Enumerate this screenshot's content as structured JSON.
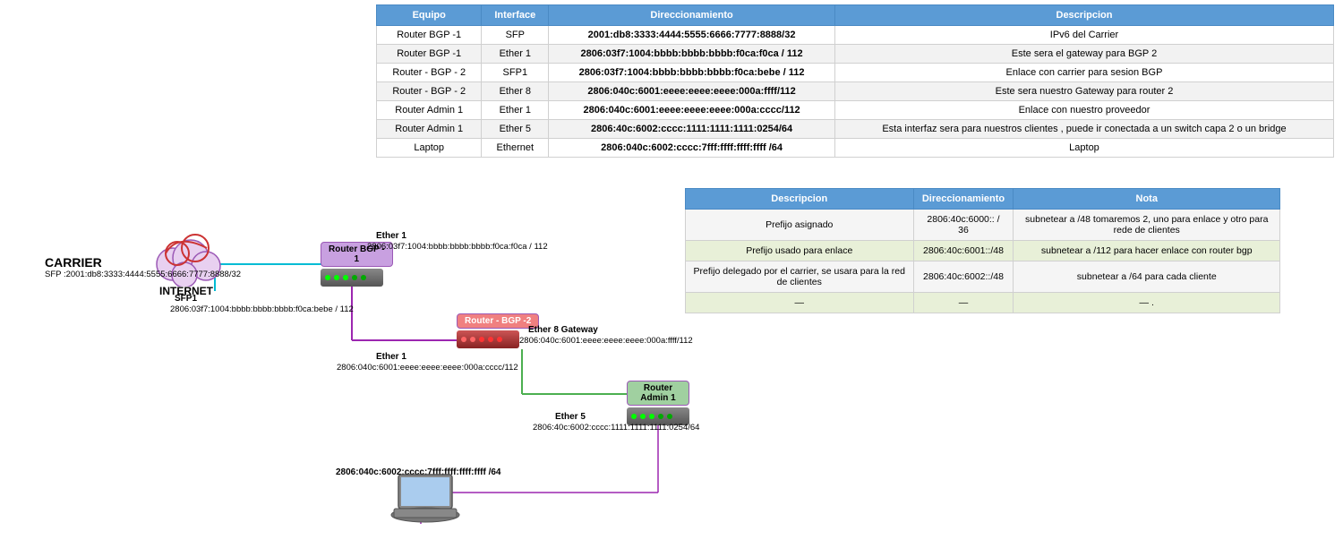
{
  "table": {
    "headers": [
      "Equipo",
      "Interface",
      "Direccionamiento",
      "Descripcion"
    ],
    "rows": [
      {
        "equipo": "Router BGP -1",
        "interface": "SFP",
        "direccionamiento": "2001:db8:3333:4444:5555:6666:7777:8888/32",
        "descripcion": "IPv6 del Carrier"
      },
      {
        "equipo": "Router BGP -1",
        "interface": "Ether 1",
        "direccionamiento": "2806:03f7:1004:bbbb:bbbb:bbbb:f0ca:f0ca / 112",
        "descripcion": "Este sera el gateway para BGP 2"
      },
      {
        "equipo": "Router - BGP - 2",
        "interface": "SFP1",
        "direccionamiento": "2806:03f7:1004:bbbb:bbbb:bbbb:f0ca:bebe / 112",
        "descripcion": "Enlace con carrier para sesion BGP"
      },
      {
        "equipo": "Router - BGP - 2",
        "interface": "Ether 8",
        "direccionamiento": "2806:040c:6001:eeee:eeee:eeee:000a:ffff/112",
        "descripcion": "Este sera nuestro Gateway para router 2"
      },
      {
        "equipo": "Router Admin 1",
        "interface": "Ether 1",
        "direccionamiento": "2806:040c:6001:eeee:eeee:eeee:000a:cccc/112",
        "descripcion": "Enlace con nuestro proveedor"
      },
      {
        "equipo": "Router Admin 1",
        "interface": "Ether 5",
        "direccionamiento": "2806:40c:6002:cccc:1111:1111:1111:0254/64",
        "descripcion": "Esta interfaz sera para nuestros clientes , puede ir conectada a un switch capa 2 o un bridge"
      },
      {
        "equipo": "Laptop",
        "interface": "Ethernet",
        "direccionamiento": "2806:040c:6002:cccc:7fff:ffff:ffff:ffff /64",
        "descripcion": "Laptop"
      }
    ]
  },
  "info_table": {
    "headers": [
      "Descripcion",
      "Direccionamiento",
      "Nota"
    ],
    "rows": [
      {
        "desc": "Prefijo asignado",
        "dir": "2806:40c:6000:: / 36",
        "nota": "subnetear a /48  tomaremos 2, uno para enlace y otro para rede de clientes"
      },
      {
        "desc": "Prefijo usado para enlace",
        "dir": "2806:40c:6001::/48",
        "nota": "subnetear a /112 para hacer enlace con router bgp"
      },
      {
        "desc": "Prefijo delegado por el carrier, se usara para la red de clientes",
        "dir": "2806:40c:6002::/48",
        "nota": "subnetear a /64 para cada cliente"
      },
      {
        "desc": "—",
        "dir": "—",
        "nota": "—  ."
      }
    ]
  },
  "diagram": {
    "internet_label": "INTERNET",
    "carrier_label": "CARRIER",
    "carrier_sfp": "SFP :2001:db8:3333:4444:5555:6666:7777:8888/32",
    "rbgp1_label": "Router BGP -\n1",
    "rbgp1_ether1": "Ether 1",
    "rbgp1_ether1_addr": "2806:03f7:1004:bbbb:bbbb:bbbb:f0ca:f0ca / 112",
    "rbgp2_label": "Router - BGP -2",
    "rbgp2_sfp1": "SFP1",
    "rbgp2_sfp1_addr": "2806:03f7:1004:bbbb:bbbb:bbbb:f0ca:bebe / 112",
    "rbgp2_ether8": "Ether 8 Gateway",
    "rbgp2_ether8_addr": "2806:040c:6001:eeee:eeee:eeee:000a:ffff/112",
    "radmin1_label": "Router Admin 1",
    "radmin1_ether1": "Ether 1",
    "radmin1_ether1_addr": "2806:040c:6001:eeee:eeee:eeee:000a:cccc/112",
    "radmin1_ether5": "Ether 5",
    "radmin1_ether5_addr": "2806:40c:6002:cccc:1111:1111:1111:0254/64",
    "laptop_addr": "2806:040c:6002:cccc:7fff:ffff:ffff:ffff /64"
  }
}
